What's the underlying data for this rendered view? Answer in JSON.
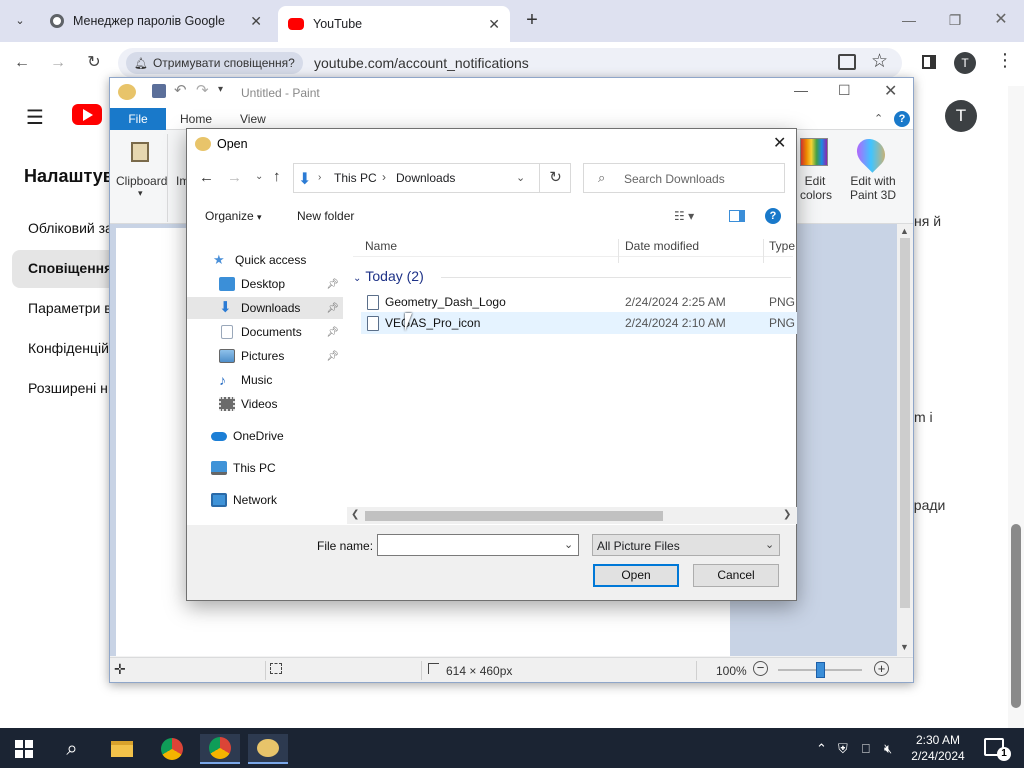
{
  "browser": {
    "tabs": [
      {
        "title": "Менеджер паролів Google",
        "active": false
      },
      {
        "title": "YouTube",
        "active": true
      }
    ],
    "address_chip": "Отримувати сповіщення?",
    "url": "youtube.com/account_notifications",
    "profile_initial": "T"
  },
  "youtube": {
    "avatar_initial": "T",
    "heading": "Налаштув",
    "nav_items": [
      "Обліковий за",
      "Сповіщення",
      "Параметри в",
      "Конфіденцій",
      "Розширені н"
    ],
    "active_nav_index": 1,
    "right_text": [
      "ня й",
      "m і",
      "оради"
    ]
  },
  "paint": {
    "title": "Untitled - Paint",
    "tabs": {
      "file": "File",
      "home": "Home",
      "view": "View"
    },
    "ribbon": {
      "clipboard": "Clipboard",
      "image_partial": "Im",
      "edit_colors_1": "Edit",
      "edit_colors_2": "colors",
      "paint3d_1": "Edit with",
      "paint3d_2": "Paint 3D"
    },
    "status": {
      "size": "614 × 460px",
      "zoom": "100%"
    }
  },
  "dialog": {
    "title": "Open",
    "breadcrumb": [
      "This PC",
      "Downloads"
    ],
    "search_placeholder": "Search Downloads",
    "organize": "Organize",
    "new_folder": "New folder",
    "nav": [
      {
        "label": "Quick access",
        "icon": "star-icon",
        "color": "#4a90d9"
      },
      {
        "label": "Desktop",
        "icon": "desktop-icon",
        "color": "#3b8fd8",
        "pin": true
      },
      {
        "label": "Downloads",
        "icon": "download-icon",
        "color": "#2b7bd4",
        "pin": true,
        "selected": true
      },
      {
        "label": "Documents",
        "icon": "documents-icon",
        "color": "#9aa8ba",
        "pin": true
      },
      {
        "label": "Pictures",
        "icon": "pictures-icon",
        "color": "#5d9fd8",
        "pin": true
      },
      {
        "label": "Music",
        "icon": "music-icon",
        "color": "#2b6fc4"
      },
      {
        "label": "Videos",
        "icon": "videos-icon",
        "color": "#6b6b6b"
      },
      {
        "label": "OneDrive",
        "icon": "onedrive-icon",
        "color": "#1c7fd6"
      },
      {
        "label": "This PC",
        "icon": "this-pc-icon",
        "color": "#3f93d8"
      },
      {
        "label": "Network",
        "icon": "network-icon",
        "color": "#3f93d8"
      }
    ],
    "columns": {
      "name": "Name",
      "date": "Date modified",
      "type": "Type"
    },
    "group": "Today (2)",
    "files": [
      {
        "name": "Geometry_Dash_Logo",
        "date": "2/24/2024 2:25 AM",
        "type": "PNG"
      },
      {
        "name": "VEGAS_Pro_icon",
        "date": "2/24/2024 2:10 AM",
        "type": "PNG"
      }
    ],
    "file_name_label": "File name:",
    "file_name_value": "",
    "file_type": "All Picture Files",
    "open_button": "Open",
    "cancel_button": "Cancel"
  },
  "taskbar": {
    "time": "2:30 AM",
    "date": "2/24/2024",
    "notification_count": "1"
  }
}
